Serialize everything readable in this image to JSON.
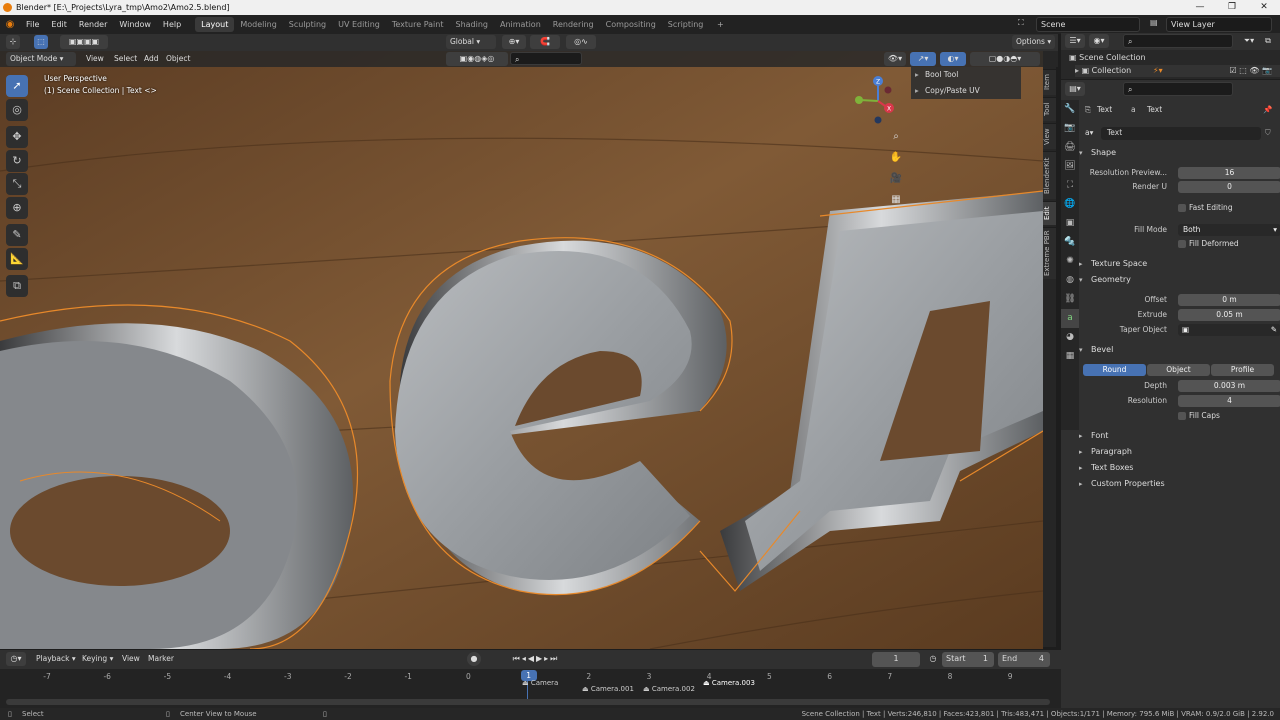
{
  "window": {
    "title": "Blender* [E:\\_Projects\\Lyra_tmp\\Amo2\\Amo2.5.blend]",
    "controls": [
      "—",
      "❐",
      "✕"
    ]
  },
  "menu": [
    "File",
    "Edit",
    "Render",
    "Window",
    "Help"
  ],
  "workspaces": [
    {
      "label": "Layout",
      "active": true
    },
    {
      "label": "Modeling"
    },
    {
      "label": "Sculpting"
    },
    {
      "label": "UV Editing"
    },
    {
      "label": "Texture Paint"
    },
    {
      "label": "Shading"
    },
    {
      "label": "Animation"
    },
    {
      "label": "Rendering"
    },
    {
      "label": "Compositing"
    },
    {
      "label": "Scripting"
    }
  ],
  "scene": {
    "name": "Scene",
    "view_layer": "View Layer"
  },
  "header": {
    "transform_orientation": "Global",
    "options": "Options",
    "mode": "Object Mode",
    "view": "View",
    "select": "Select",
    "add": "Add",
    "object": "Object"
  },
  "viewport": {
    "perspective": "User Perspective",
    "collection_info": "(1) Scene Collection | Text <>",
    "addon_panels": [
      "Bool Tool",
      "Copy/Paste UV"
    ],
    "side_tabs": [
      "Item",
      "Tool",
      "View",
      "BlenderKit",
      "Edit",
      "Extreme PBR"
    ],
    "gizmo_axes": [
      "Z",
      "Y",
      "X"
    ]
  },
  "outliner": {
    "root": "Scene Collection",
    "child": "Collection"
  },
  "properties": {
    "breadcrumb_object": "Text",
    "breadcrumb_data": "Text",
    "datablock": "Text",
    "shape": {
      "title": "Shape",
      "resolution_preview_label": "Resolution Preview...",
      "resolution_preview": "16",
      "render_u_label": "Render U",
      "render_u": "0",
      "fast_editing": "Fast Editing",
      "fill_mode_label": "Fill Mode",
      "fill_mode": "Both",
      "fill_deformed": "Fill Deformed"
    },
    "texture_space": "Texture Space",
    "geometry": {
      "title": "Geometry",
      "offset_label": "Offset",
      "offset": "0 m",
      "extrude_label": "Extrude",
      "extrude": "0.05 m",
      "taper_label": "Taper Object"
    },
    "bevel": {
      "title": "Bevel",
      "modes": [
        "Round",
        "Object",
        "Profile"
      ],
      "depth_label": "Depth",
      "depth": "0.003 m",
      "resolution_label": "Resolution",
      "resolution": "4",
      "fill_caps": "Fill Caps"
    },
    "closed_sections": [
      "Font",
      "Paragraph",
      "Text Boxes",
      "Custom Properties"
    ]
  },
  "timeline": {
    "menu": [
      "Playback",
      "Keying",
      "View",
      "Marker"
    ],
    "current_frame": "1",
    "start_label": "Start",
    "start": "1",
    "end_label": "End",
    "end": "4",
    "frames": [
      "-7",
      "-6",
      "-5",
      "-4",
      "-3",
      "-2",
      "-1",
      "0",
      "1",
      "2",
      "3",
      "4",
      "5",
      "6",
      "7",
      "8",
      "9"
    ],
    "markers": [
      "Camera",
      "Camera.001",
      "Camera.002",
      "Camera.003"
    ]
  },
  "statusbar": {
    "left_action": "Select",
    "mid_action": "Center View to Mouse",
    "stats": "Scene Collection | Text | Verts:246,810 | Faces:423,801 | Tris:483,471 | Objects:1/171 | Memory: 795.6 MiB | VRAM: 0.9/2.0 GiB | 2.92.0"
  },
  "colors": {
    "accent": "#4772b3",
    "selection": "#e8892a",
    "brand": "#e87d0d"
  }
}
